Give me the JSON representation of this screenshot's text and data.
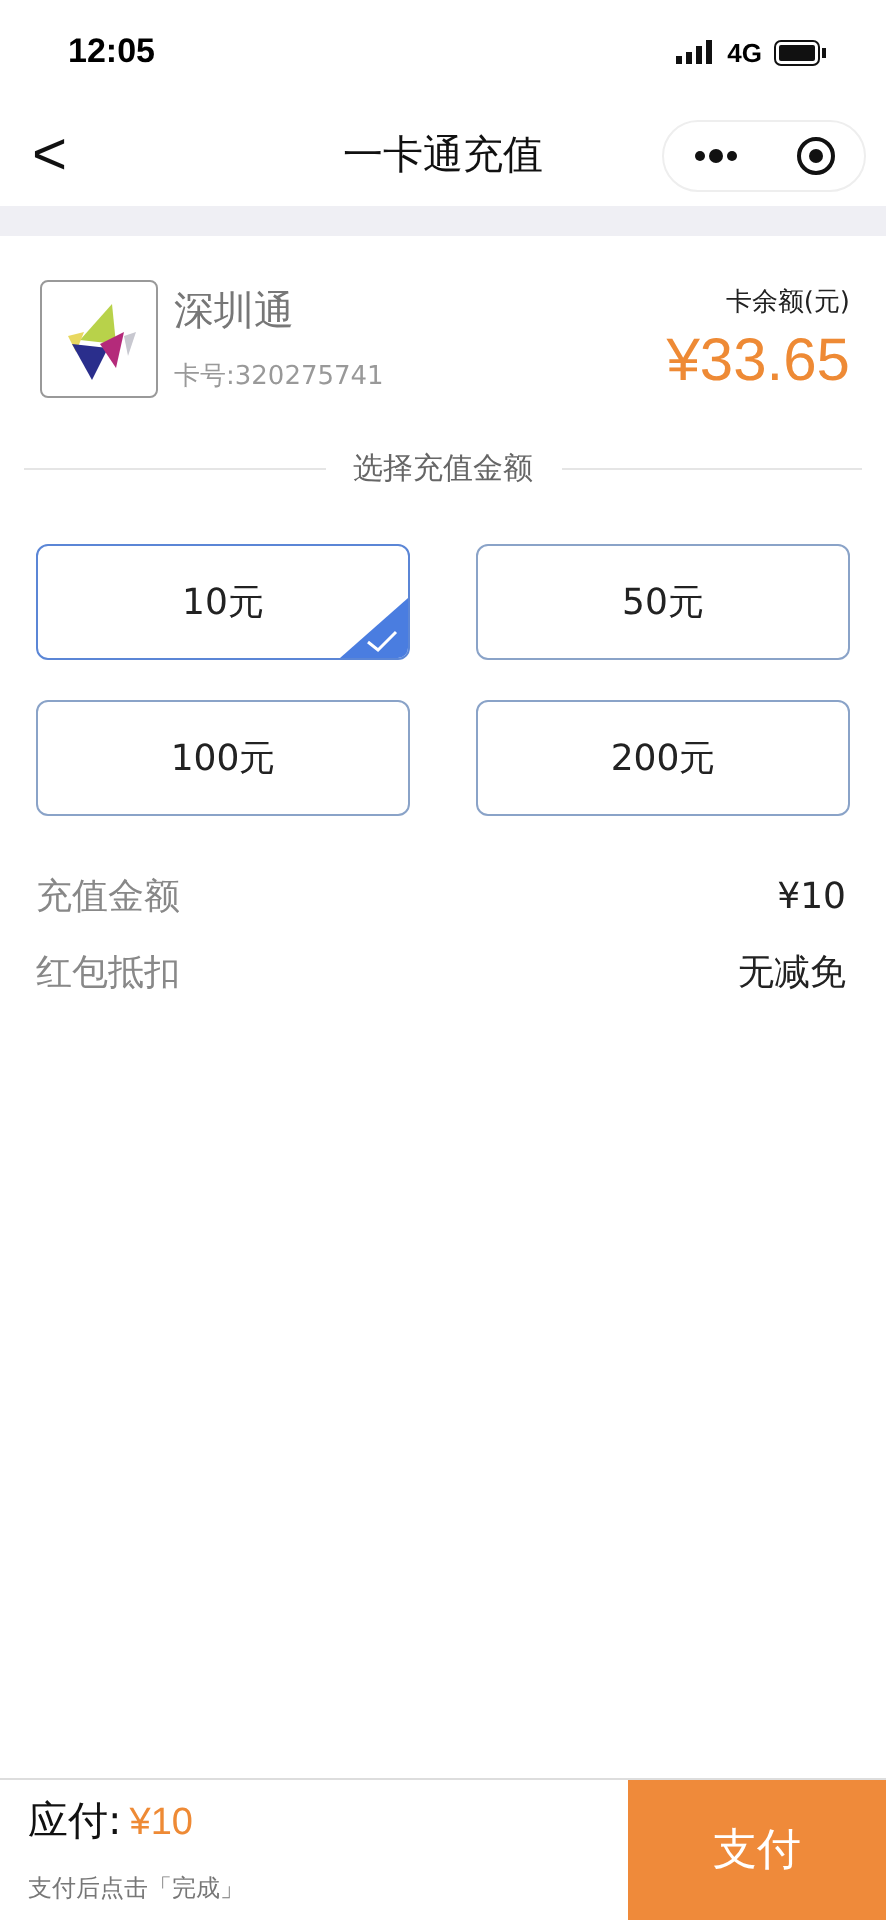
{
  "status_bar": {
    "time": "12:05",
    "network": "4G"
  },
  "nav": {
    "back": "<",
    "title": "一卡通充值"
  },
  "card": {
    "name": "深圳通",
    "number": "卡号:320275741",
    "balance_label": "卡余额(元)",
    "balance": "¥33.65"
  },
  "section_title": "选择充值金额",
  "amounts": [
    {
      "label": "10元",
      "selected": true
    },
    {
      "label": "50元",
      "selected": false
    },
    {
      "label": "100元",
      "selected": false
    },
    {
      "label": "200元",
      "selected": false
    }
  ],
  "summary": [
    {
      "label": "充值金额",
      "value": "¥10"
    },
    {
      "label": "红包抵扣",
      "value": "无减免"
    }
  ],
  "footer": {
    "due_label": "应付:",
    "due_amount": "¥10",
    "note": "支付后点击「完成」",
    "pay_button": "支付"
  }
}
